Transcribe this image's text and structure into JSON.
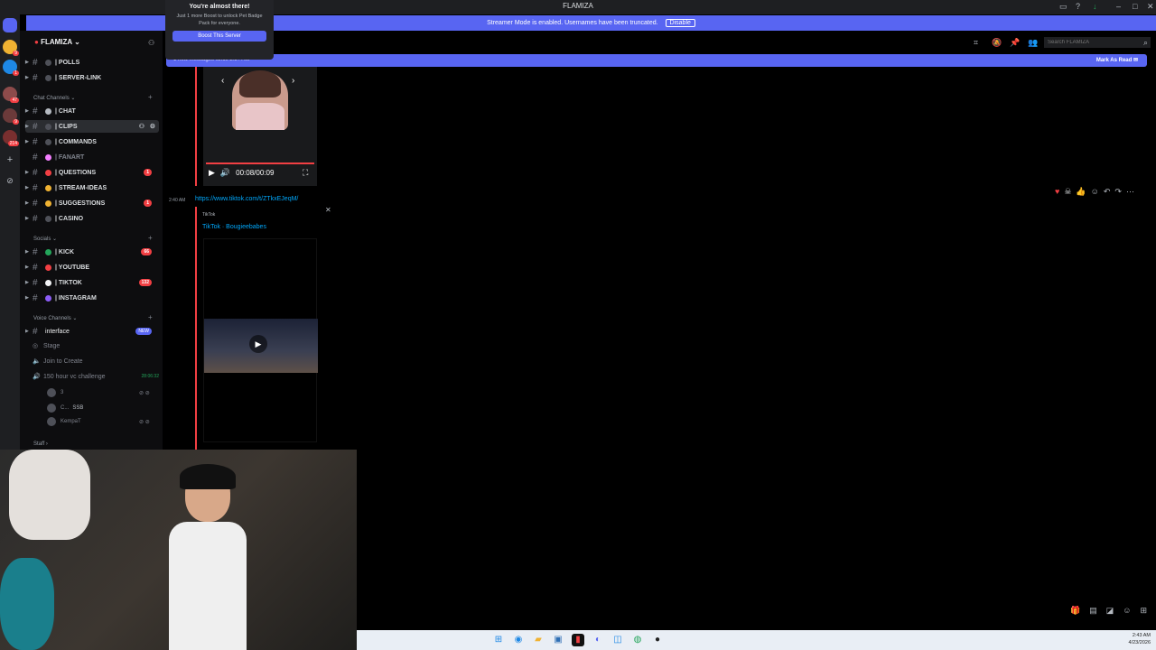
{
  "window": {
    "title": "FLAMIZA"
  },
  "banner": {
    "text": "Streamer Mode is enabled. Usernames have been truncated.",
    "disable_label": "Disable"
  },
  "popup": {
    "title": "You're almost there!",
    "body": "Just 1 more Boost to unlock Pet Badge Pack for everyone.",
    "button": "Boost This Server"
  },
  "server": {
    "name": "FLAMIZA"
  },
  "channels_top": [
    {
      "label": "| POLLS",
      "dot": "#4e5058"
    },
    {
      "label": "| SERVER-LINK",
      "dot": "#4e5058"
    }
  ],
  "chat_category": "Chat Channels",
  "chat_channels": [
    {
      "label": "| CHAT",
      "dot": "#b5bac1",
      "badge": ""
    },
    {
      "label": "| CLIPS",
      "dot": "#4e5058",
      "badge": ""
    },
    {
      "label": "| COMMANDS",
      "dot": "#4e5058",
      "badge": ""
    },
    {
      "label": "| FANART",
      "dot": "#f47fff",
      "badge": ""
    },
    {
      "label": "| QUESTIONS",
      "dot": "#f23f43",
      "badge": "1"
    },
    {
      "label": "| STREAM-IDEAS",
      "dot": "#f0b232",
      "badge": ""
    },
    {
      "label": "| SUGGESTIONS",
      "dot": "#f0b232",
      "badge": "1"
    },
    {
      "label": "| CASINO",
      "dot": "#4e5058",
      "badge": ""
    }
  ],
  "socials_category": "Socials",
  "social_channels": [
    {
      "label": "| KICK",
      "dot": "#23a55a",
      "badge": "66"
    },
    {
      "label": "| YOUTUBE",
      "dot": "#f23f43",
      "badge": ""
    },
    {
      "label": "| TIKTOK",
      "dot": "#f2f3f5",
      "badge": "132"
    },
    {
      "label": "| INSTAGRAM",
      "dot": "#8b5cf6",
      "badge": ""
    }
  ],
  "voice_category": "Voice Channels",
  "voice": {
    "interface": {
      "label": "interface",
      "badge": "NEW"
    },
    "stage": "Stage",
    "join": "Join to Create",
    "challenge": {
      "label": "150 hour vc challenge",
      "time": "28:06:32"
    },
    "users": [
      "3",
      "C...",
      "KempaT"
    ],
    "user2_tag": "SSB"
  },
  "staff_category": "Staff",
  "search": {
    "placeholder": "Search FLAMIZA"
  },
  "newbar": {
    "left": "1 new messages since 2:3? AM",
    "right": "Mark As Read"
  },
  "video": {
    "time": "00:08/00:09"
  },
  "message": {
    "time": "2:40 AM",
    "link": "https://www.tiktok.com/t/ZTkxEJeqM/",
    "embed_provider": "TikTok",
    "embed_title": "TikTok · Bougieebabes"
  },
  "taskbar": {
    "time": "2:43 AM",
    "date": "4/23/2026"
  }
}
